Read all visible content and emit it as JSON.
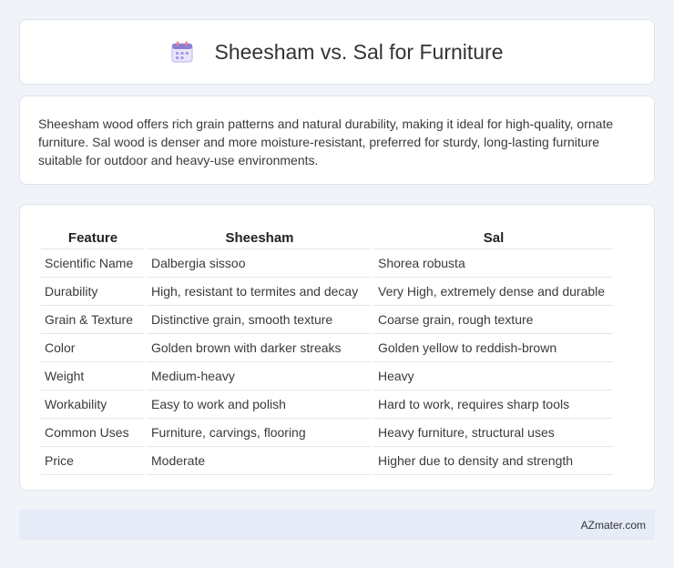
{
  "header": {
    "title": "Sheesham vs. Sal for Furniture",
    "icon": "calendar-icon"
  },
  "description": "Sheesham wood offers rich grain patterns and natural durability, making it ideal for high-quality, ornate furniture. Sal wood is denser and more moisture-resistant, preferred for sturdy, long-lasting furniture suitable for outdoor and heavy-use environments.",
  "table": {
    "headers": [
      "Feature",
      "Sheesham",
      "Sal"
    ],
    "rows": [
      [
        "Scientific Name",
        "Dalbergia sissoo",
        "Shorea robusta"
      ],
      [
        "Durability",
        "High, resistant to termites and decay",
        "Very High, extremely dense and durable"
      ],
      [
        "Grain & Texture",
        "Distinctive grain, smooth texture",
        "Coarse grain, rough texture"
      ],
      [
        "Color",
        "Golden brown with darker streaks",
        "Golden yellow to reddish-brown"
      ],
      [
        "Weight",
        "Medium-heavy",
        "Heavy"
      ],
      [
        "Workability",
        "Easy to work and polish",
        "Hard to work, requires sharp tools"
      ],
      [
        "Common Uses",
        "Furniture, carvings, flooring",
        "Heavy furniture, structural uses"
      ],
      [
        "Price",
        "Moderate",
        "Higher due to density and strength"
      ]
    ]
  },
  "footer": {
    "brand": "AZmater.com"
  },
  "colors": {
    "background": "#f0f3f8",
    "card": "#ffffff",
    "footer": "#e6ecf7",
    "icon_accent": "#8a7fd6"
  }
}
